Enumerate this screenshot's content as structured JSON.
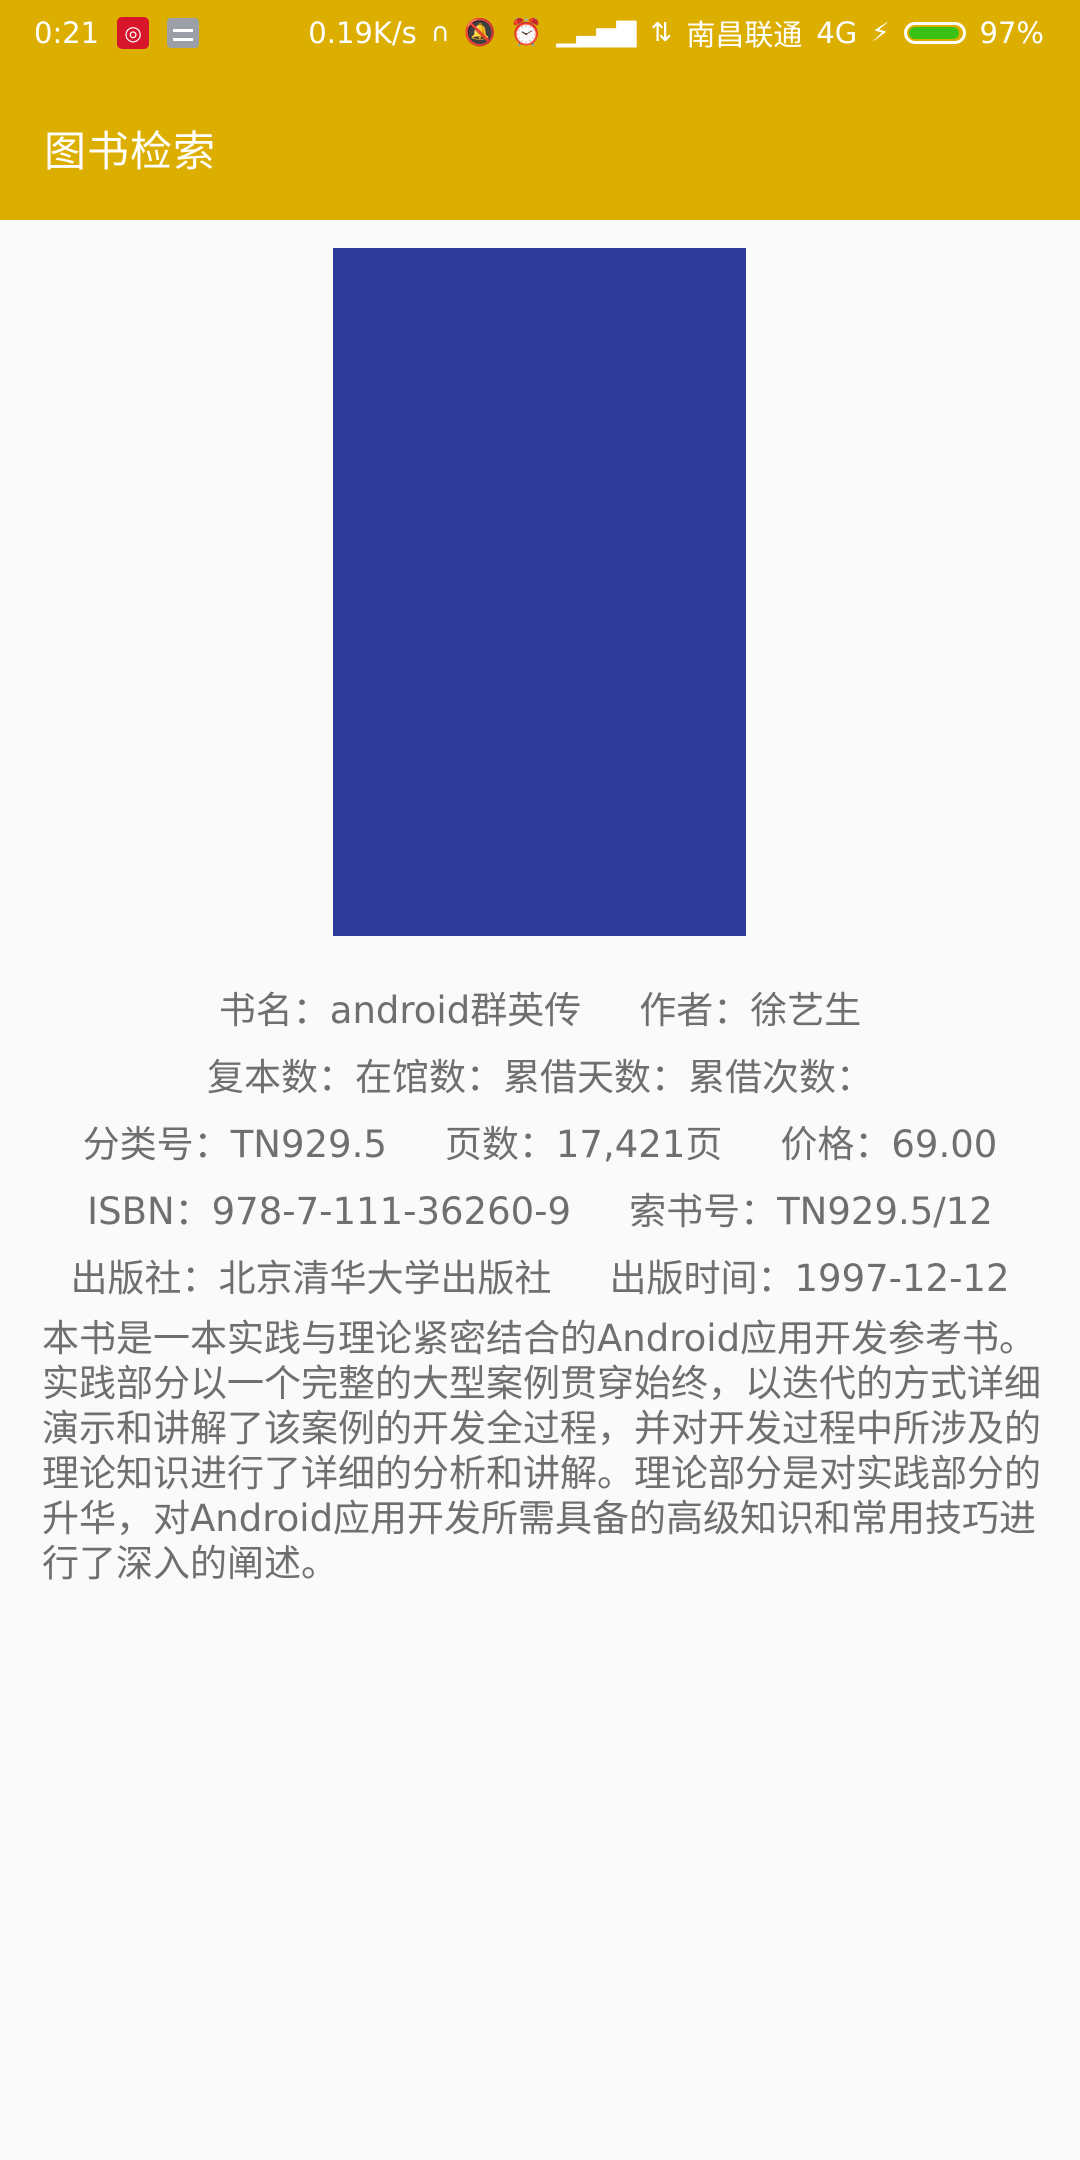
{
  "status_bar": {
    "time": "0:21",
    "speed": "0.19K/s",
    "carrier": "南昌联通",
    "network": "4G",
    "battery": "97%",
    "battery_level": 0.97,
    "icons": [
      "netease-music-icon",
      "notification-icon",
      "headphones-icon",
      "mute-bell-icon",
      "alarm-icon",
      "signal-icon",
      "data-arrows-icon",
      "charging-icon"
    ]
  },
  "app_bar": {
    "title": "图书检索"
  },
  "book": {
    "line1": {
      "title_label": "书名：",
      "title": "android群英传",
      "author_label": "作者：",
      "author": "徐艺生"
    },
    "line2": {
      "copies": "复本数：在馆数：累借天数：累借次数："
    },
    "line3": {
      "class_label": "分类号：",
      "class_no": "TN929.5",
      "pages_label": "页数：",
      "pages": "17,421页",
      "price_label": "价格：",
      "price": "69.00"
    },
    "line4": {
      "isbn_label": "ISBN：",
      "isbn": "978-7-111-36260-9",
      "call_label": "索书号：",
      "call_no": "TN929.5/12"
    },
    "line5": {
      "publisher_label": "出版社：",
      "publisher": "北京清华大学出版社",
      "date_label": "出版时间：",
      "date": "1997-12-12"
    },
    "description": "本书是一本实践与理论紧密结合的Android应用开发参考书。实践部分以一个完整的大型案例贯穿始终，以迭代的方式详细演示和讲解了该案例的开发全过程，并对开发过程中所涉及的理论知识进行了详细的分析和讲解。理论部分是对实践部分的升华，对Android应用开发所需具备的高级知识和常用技巧进行了深入的阐述。"
  },
  "colors": {
    "accent": "#dcae00",
    "cover": "#2f3c9c",
    "text": "#6f6f6f",
    "background": "#fafafa"
  }
}
